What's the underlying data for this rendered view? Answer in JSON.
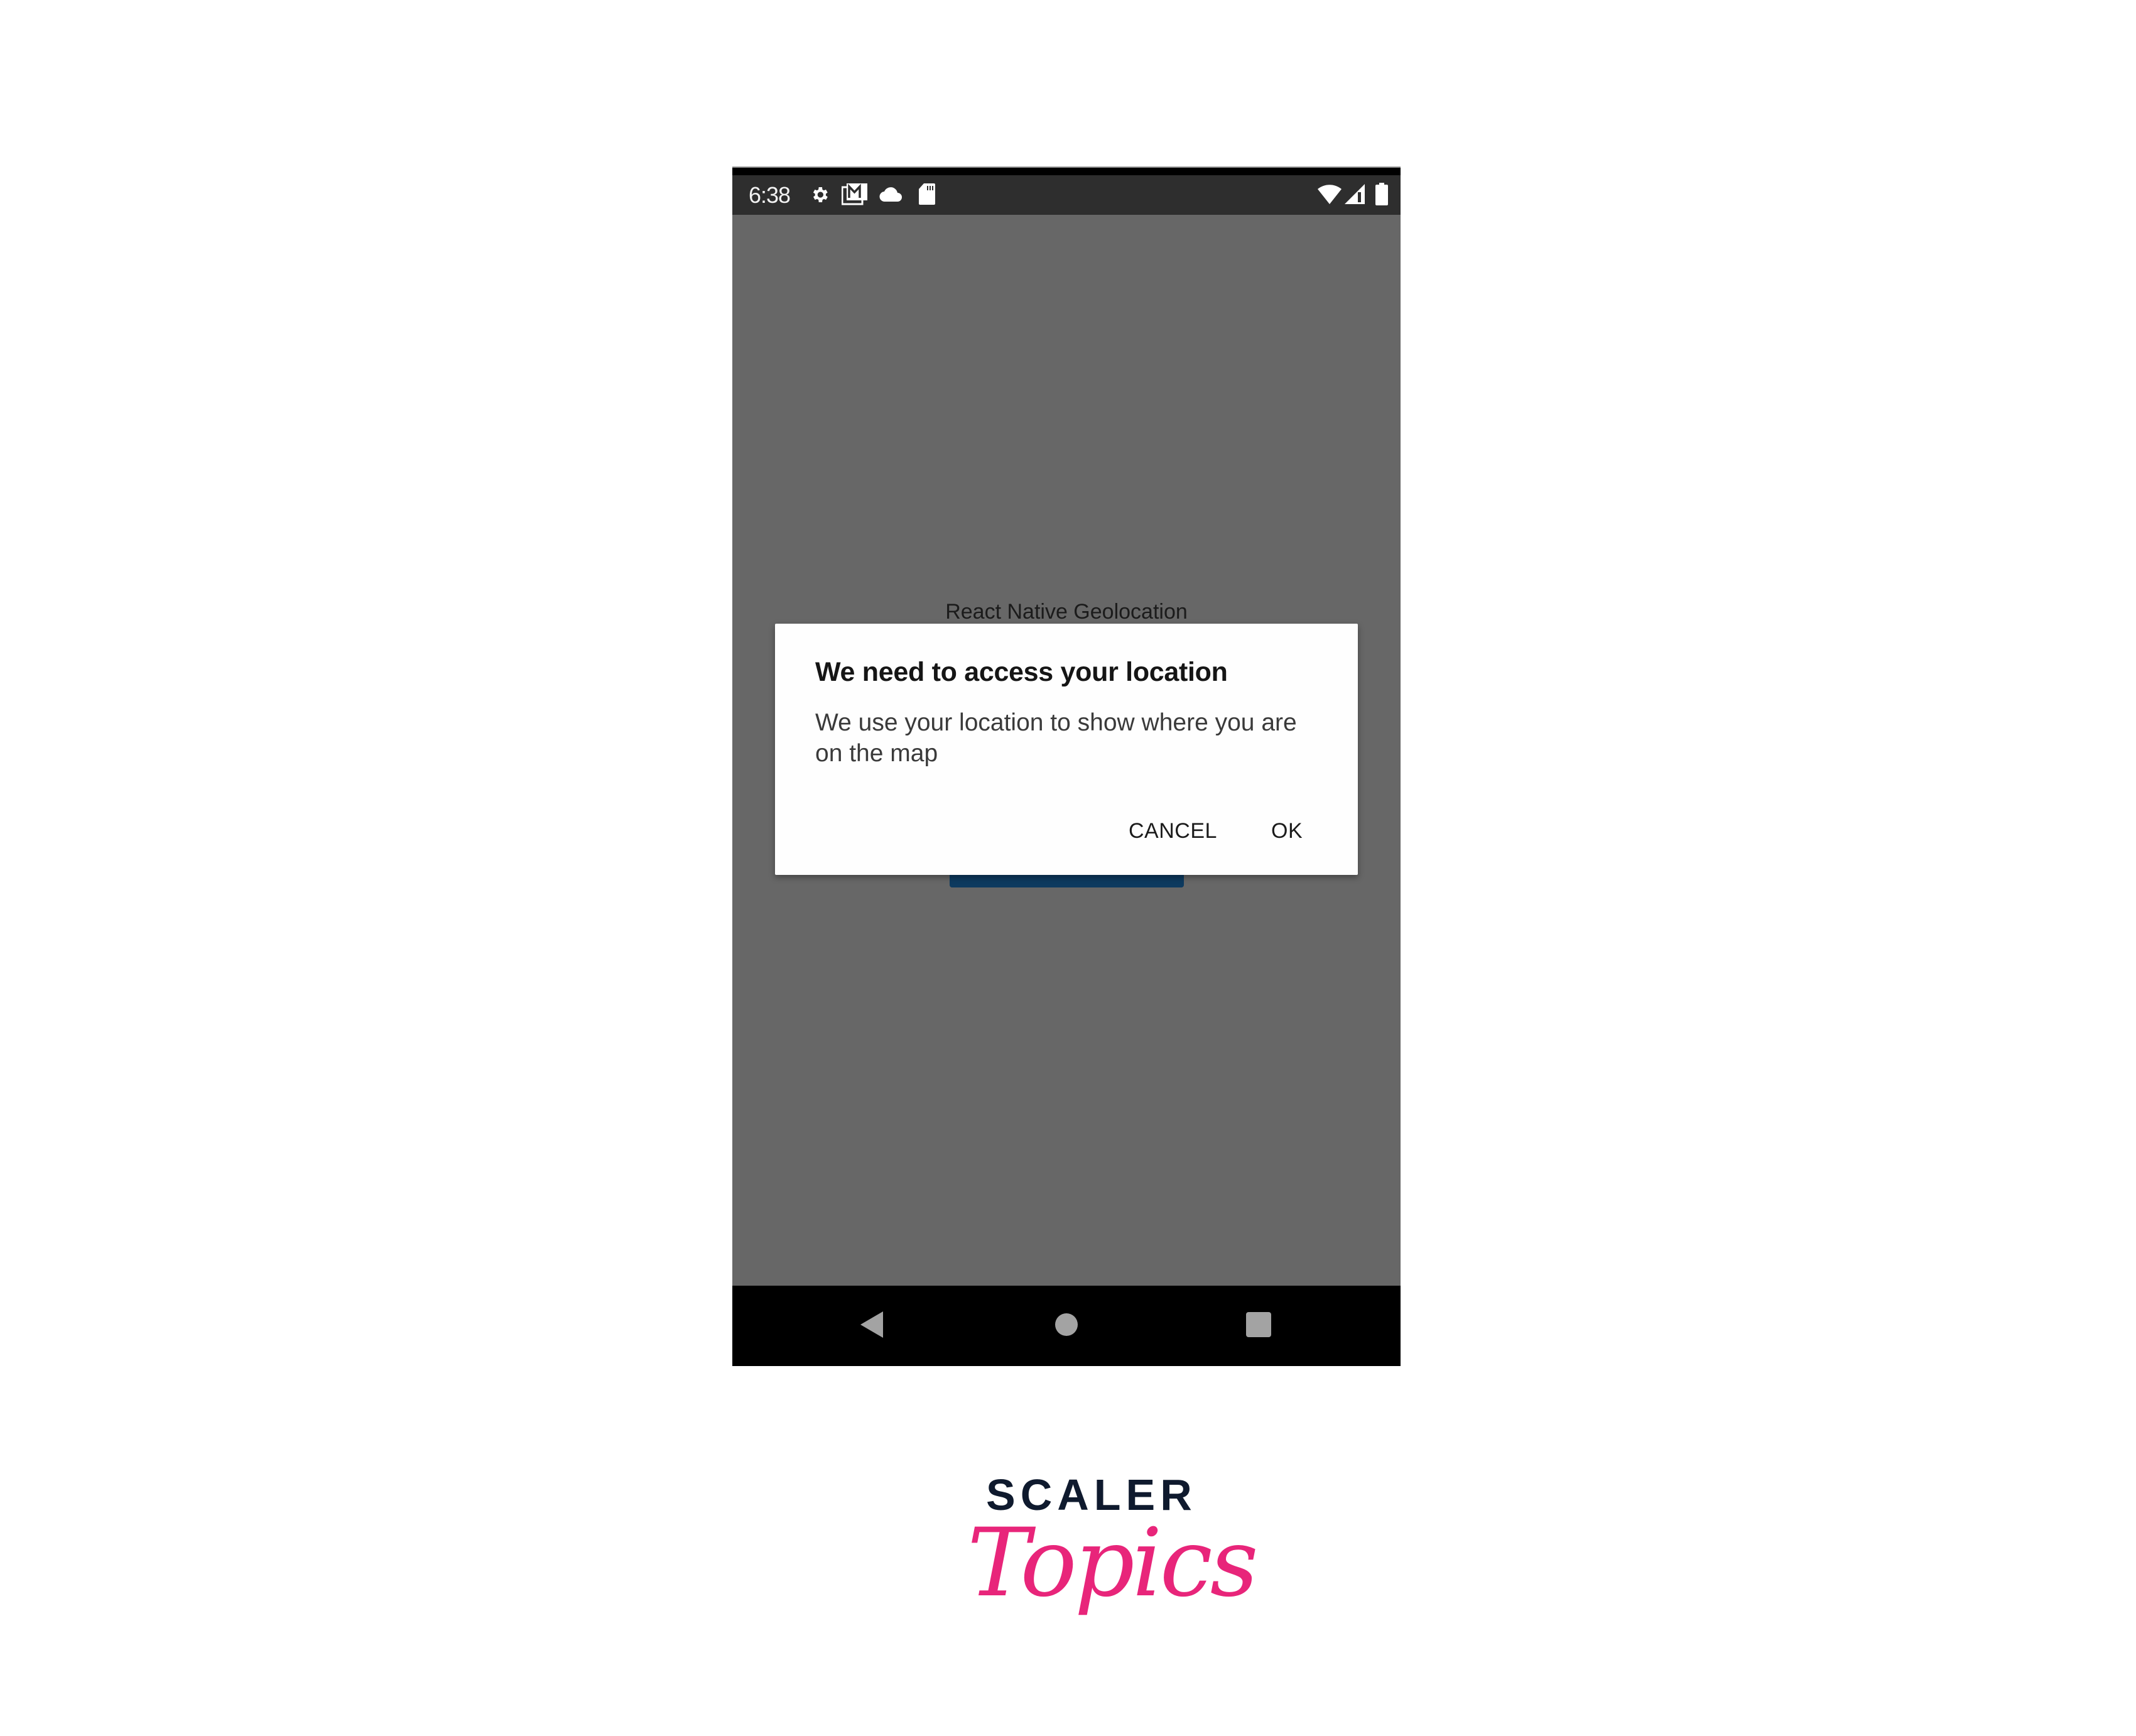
{
  "status_bar": {
    "time": "6:38",
    "left_icons": [
      "settings-gear-icon",
      "gmail-icon",
      "cloud-icon",
      "sd-card-icon"
    ],
    "right_icons": [
      "wifi-icon",
      "cellular-signal-icon",
      "battery-icon"
    ]
  },
  "app": {
    "title": "React Native Geolocation",
    "button_color": "#0d3a5f"
  },
  "dialog": {
    "title": "We need to access your location",
    "message": "We use your location to show where you are on the map",
    "buttons": {
      "cancel": "CANCEL",
      "ok": "OK"
    }
  },
  "nav_bar": {
    "back": "back-icon",
    "home": "home-icon",
    "recents": "recents-icon"
  },
  "branding": {
    "line1": "SCALER",
    "line2": "Topics",
    "colors": {
      "scaler": "#0f1a2e",
      "topics": "#e8257a"
    }
  }
}
